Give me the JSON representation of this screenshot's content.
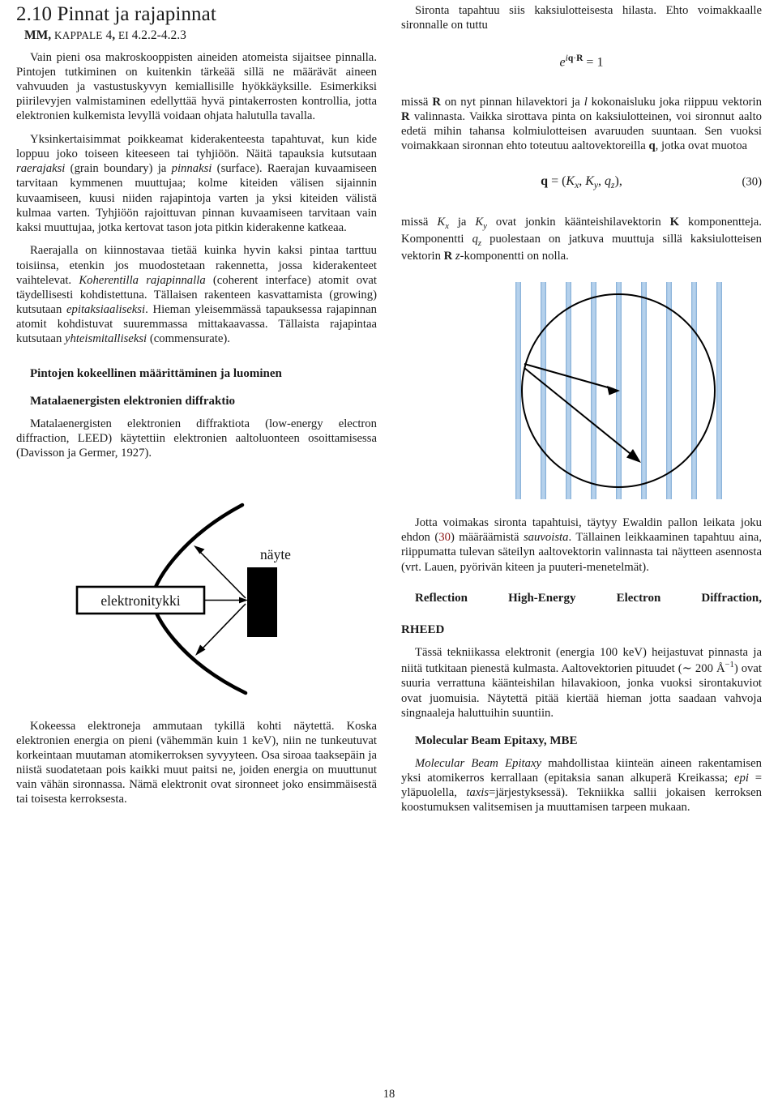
{
  "document": {
    "page_number": "18",
    "accent_link_color": "#8c1515",
    "rod_color": "#a9c9e8"
  },
  "left_column": {
    "section_title": "2.10 Pinnat ja rajapinnat",
    "source_line": {
      "bold_part": "MM",
      "smallcaps_1": "kappale",
      "num_1": "4",
      "smallcaps_2": "ei",
      "num_2": "4.2.2-4.2.3",
      "full": "MM, KAPPALE 4, EI 4.2.2-4.2.3"
    },
    "paragraphs": [
      "Vain pieni osa makroskooppisten aineiden atomeista sijaitsee pinnalla. Pintojen tutkiminen on kuitenkin tärkeää sillä ne määrävät aineen vahvuuden ja vastustuskyvyn kemiallisille hyökkäyksille. Esimerkiksi piirilevyjen valmistaminen edellyttää hyvä pintakerrosten kontrollia, jotta elektronien kulkemista levyllä voidaan ohjata halutulla tavalla.",
      "Yksinkertaisimmat poikkeamat kiderakenteesta tapahtuvat, kun kide loppuu joko toiseen kiteeseen tai tyhjiöön. Näitä tapauksia kutsutaan raerajaksi (grain boundary) ja pinnaksi (surface). Raerajan kuvaamiseen tarvitaan kymmenen muuttujaa; kolme kiteiden välisen sijainnin kuvaamiseen, kuusi niiden rajapintoja varten ja yksi kiteiden välistä kulmaa varten. Tyhjiöön rajoittuvan pinnan kuvaamiseen tarvitaan vain kaksi muuttujaa, jotka kertovat tason jota pitkin kiderakenne katkeaa.",
      "Raerajalla on kiinnostavaa tietää kuinka hyvin kaksi pintaa tarttuu toisiinsa, etenkin jos muodostetaan rakennetta, jossa kiderakenteet vaihtelevat. Koherentilla rajapinnalla (coherent interface) atomit ovat täydellisesti kohdistettuna. Tällaisen rakenteen kasvattamista (growing) kutsutaan epitaksiaaliseksi. Hieman yleisemmässä tapauksessa rajapinnan atomit kohdistuvat suuremmassa mittakaavassa. Tällaista rajapintaa kutsutaan yhteismitalliseksi (commensurate)."
    ],
    "para2_italics": [
      "raerajaksi",
      "pinnaksi"
    ],
    "para3_italics": [
      "Koherentilla rajapinnalla",
      "epitaksiaaliseksi",
      "yhteismitalliseksi"
    ],
    "heading_experimental": "Pintojen kokeellinen määrittäminen ja luominen",
    "heading_leed": "Matalaenergisten elektronien diffraktio",
    "leed_intro": "Matalaenergisten elektronien diffraktiota (low-energy electron diffraction, LEED) käytettiin elektronien aaltoluonteen osoittamisessa (Davisson ja Germer, 1927).",
    "figure_leed": {
      "gun_label": "elektronitykki",
      "sample_label": "näyte"
    },
    "leed_tail": "Kokeessa elektroneja ammutaan tykillä kohti näytettä. Koska elektronien energia on pieni (vähemmän kuin 1 keV), niin ne tunkeutuvat korkeintaan muutaman atomikerroksen syvyyteen. Osa siroaa taaksepäin ja niistä suodatetaan pois kaikki muut paitsi ne, joiden energia on muuttunut vain vähän sironnassa. Nämä elektronit ovat sironneet joko ensimmäisestä tai toisesta kerroksesta."
  },
  "right_column": {
    "para_intro": "Sironta tapahtuu siis kaksiulotteisesta hilasta. Ehto voimakkaalle sironnalle on tuttu",
    "equation_1": {
      "base": "e",
      "exponent": "iq·R",
      "rhs": "= 1"
    },
    "para_after_eq1": "missä R on nyt pinnan hilavektori ja l kokonaisluku joka riippuu vektorin R valinnasta. Vaikka sirottava pinta on kaksiulotteinen, voi sironnut aalto edetä mihin tahansa kolmiulotteisen avaruuden suuntaan. Sen vuoksi voimakkaan sironnan ehto toteutuu aaltovektoreilla q, jotka ovat muotoa",
    "equation_2": {
      "lhs": "q",
      "rhs": "= (K x , K y , q z ),",
      "number": "(30)"
    },
    "para_after_eq2": "missä K x ja K y ovat jonkin käänteishilavektorin K komponentteja. Komponentti q z puolestaan on jatkuva muuttuja sillä kaksiulotteisen vektorin R z-komponentti on nolla.",
    "figure_ewald": {
      "rod_count": 9,
      "description": "Ewald sphere circle crossing vertical reciprocal-lattice rods with incident and scattered wavevector arrows"
    },
    "para_ewald": "Jotta voimakas sironta tapahtuisi, täytyy Ewaldin pallon leikata joku ehdon (30) määräämistä sauvoista. Tällainen leikkaaminen tapahtuu aina, riippumatta tulevan säteilyn aaltovektorin valinnasta tai näytteen asennosta (vrt. Lauen, pyörivän kiteen ja puuteri-menetelmät).",
    "para_ewald_ref": "(30)",
    "para_ewald_italic": "sauvoista",
    "heading_rheed_line1": "Reflection High-Energy Electron Diffraction,",
    "heading_rheed_line2": "RHEED",
    "para_rheed": "Tässä tekniikassa elektronit (energia 100 keV) heijastuvat pinnasta ja niitä tutkitaan pienestä kulmasta. Aaltovektorien pituudet (∼ 200 Å⁻¹) ovat suuria verrattuna käänteishilan hilavakioon, jonka vuoksi sirontakuviot ovat juomuisia. Näytettä pitää kiertää hieman jotta saadaan vahvoja singnaaleja haluttuihin suuntiin.",
    "heading_mbe": "Molecular Beam Epitaxy, MBE",
    "para_mbe": "Molecular Beam Epitaxy mahdollistaa kiinteän aineen rakentamisen yksi atomikerros kerrallaan (epitaksia sanan alkuperä Kreikassa; epi = yläpuolella, taxis=järjestyksessä). Tekniikka sallii jokaisen kerroksen koostumuksen valitsemisen ja muuttamisen tarpeen mukaan.",
    "para_mbe_italics": [
      "Molecular Beam Epitaxy",
      "epi",
      "taxis"
    ]
  }
}
